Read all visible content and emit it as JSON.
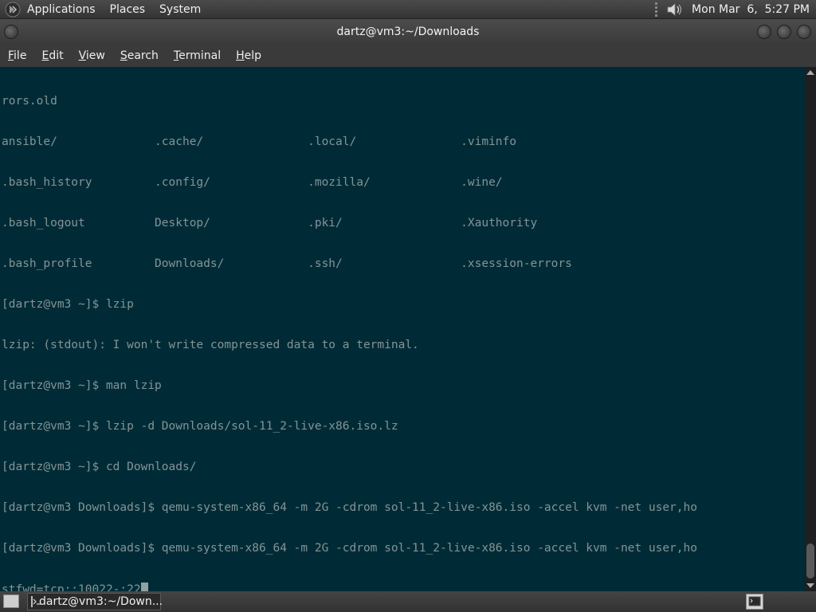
{
  "top_panel": {
    "menus": [
      "Applications",
      "Places",
      "System"
    ],
    "clock": "Mon Mar  6,  5:27 PM"
  },
  "window": {
    "title": "dartz@vm3:~/Downloads"
  },
  "menubar": {
    "items": [
      {
        "first": "F",
        "rest": "ile"
      },
      {
        "first": "E",
        "rest": "dit"
      },
      {
        "first": "V",
        "rest": "iew"
      },
      {
        "first": "S",
        "rest": "earch"
      },
      {
        "first": "T",
        "rest": "erminal"
      },
      {
        "first": "H",
        "rest": "elp"
      }
    ]
  },
  "terminal": {
    "lines": [
      "rors.old",
      "ansible/              .cache/               .local/               .viminfo",
      ".bash_history         .config/              .mozilla/             .wine/",
      ".bash_logout          Desktop/              .pki/                 .Xauthority",
      ".bash_profile         Downloads/            .ssh/                 .xsession-errors",
      "[dartz@vm3 ~]$ lzip",
      "lzip: (stdout): I won't write compressed data to a terminal.",
      "[dartz@vm3 ~]$ man lzip",
      "[dartz@vm3 ~]$ lzip -d Downloads/sol-11_2-live-x86.iso.lz",
      "[dartz@vm3 ~]$ cd Downloads/",
      "[dartz@vm3 Downloads]$ qemu-system-x86_64 -m 2G -cdrom sol-11_2-live-x86.iso -accel kvm -net user,ho",
      "[dartz@vm3 Downloads]$ qemu-system-x86_64 -m 2G -cdrom sol-11_2-live-x86.iso -accel kvm -net user,ho",
      "stfwd=tcp::10022-:22"
    ],
    "colors": {
      "background": "#002b36",
      "foreground": "#839496",
      "cursor": "#93a1a1"
    }
  },
  "taskbar": {
    "task_label": "dartz@vm3:~/Down..."
  }
}
